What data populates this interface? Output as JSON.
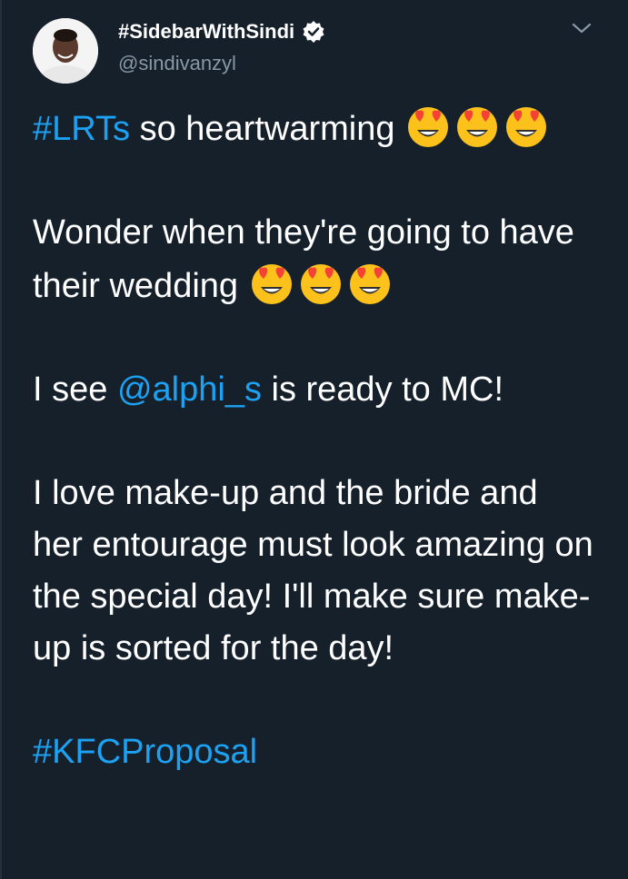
{
  "tweet": {
    "display_name": "#SidebarWithSindi",
    "handle": "@sindivanzyl",
    "verified_icon": "verified-badge-icon",
    "menu_icon": "chevron-down-icon",
    "avatar": "profile-avatar",
    "line1_hashtag": "#LRTs",
    "line1_text": " so heartwarming ",
    "line1_emoji": "heart-eyes-emoji",
    "para2_text": "Wonder when they're going to have their wedding ",
    "para3_prefix": "I see ",
    "para3_mention": "@alphi_s",
    "para3_suffix": " is ready to MC!",
    "para4_text": "I love make-up and the bride and her entourage must look amazing on the special day! I'll make sure make-up is sorted for the day!",
    "closing_hashtag": "#KFCProposal"
  },
  "colors": {
    "background": "#15202b",
    "text": "#ffffff",
    "secondary": "#8899a6",
    "link": "#1da1f2",
    "emoji_face": "#fcc21b",
    "emoji_heart": "#f44336"
  }
}
